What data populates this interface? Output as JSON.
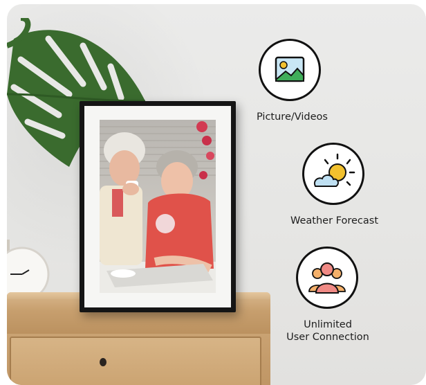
{
  "features": [
    {
      "label": "Picture/Videos",
      "icon": "picture-icon"
    },
    {
      "label": "Weather Forecast",
      "icon": "weather-icon"
    },
    {
      "label_line1": "Unlimited",
      "label_line2": "User Connection",
      "icon": "users-icon"
    }
  ],
  "colors": {
    "background": "#e8e8e6",
    "frame": "#151515",
    "wood": "#c9a272"
  }
}
